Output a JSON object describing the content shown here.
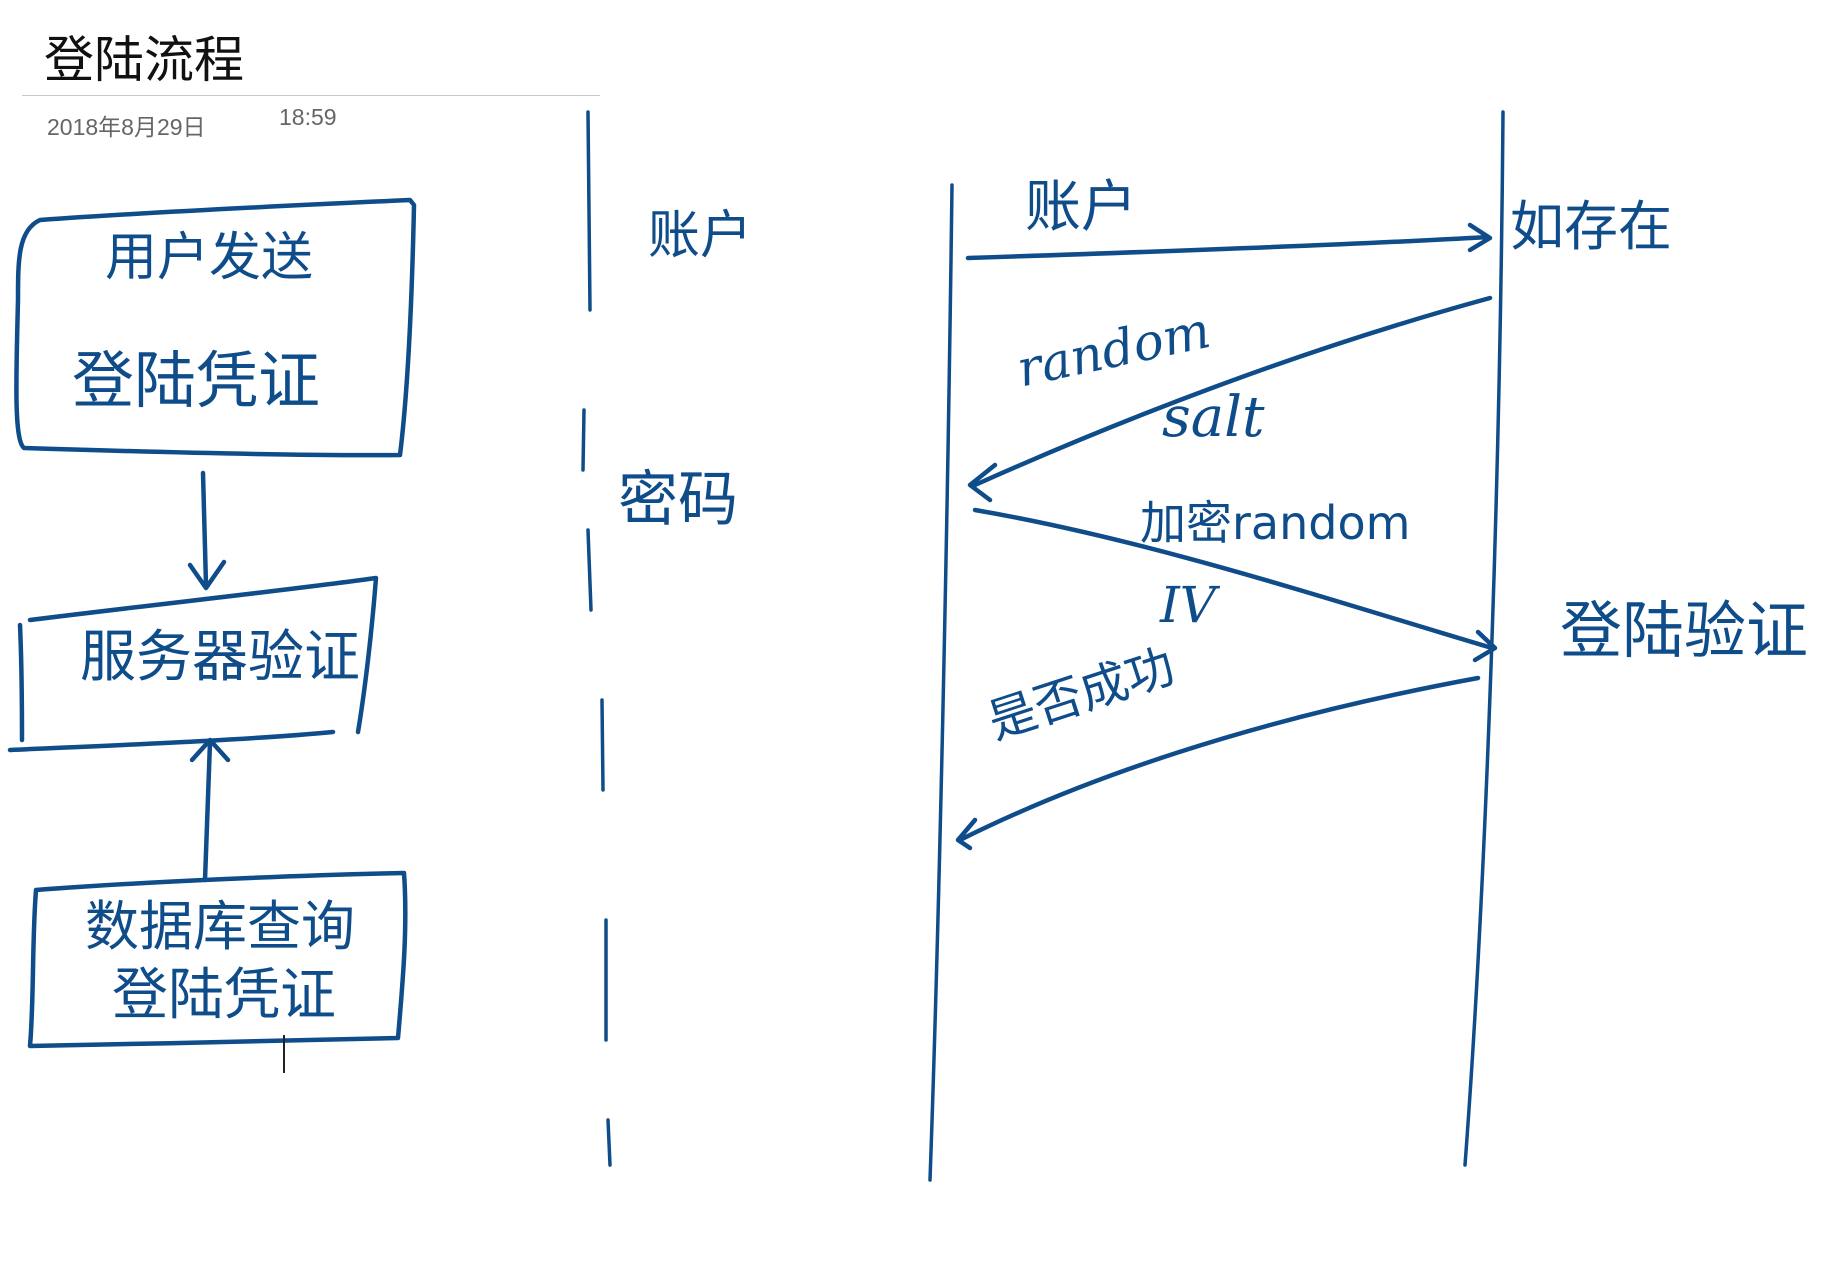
{
  "note": {
    "title": "登陆流程",
    "date": "2018年8月29日",
    "time": "18:59"
  },
  "flowchart": {
    "box_user_line1": "用户发送",
    "box_user_line2": "登陆凭证",
    "box_server": "服务器验证",
    "box_db_line1": "数据库查询",
    "box_db_line2": "登陆凭证"
  },
  "side_labels": {
    "account": "账户",
    "password": "密码"
  },
  "sequence": {
    "msg_account": "账户",
    "check_exists": "如存在",
    "msg_random": "random",
    "msg_salt": "salt",
    "msg_encrypt": "加密random",
    "msg_iv": "IV",
    "login_verify": "登陆验证",
    "msg_result": "是否成功"
  },
  "colors": {
    "ink": "#0f4c8a",
    "title": "#111111",
    "meta": "#666666"
  }
}
